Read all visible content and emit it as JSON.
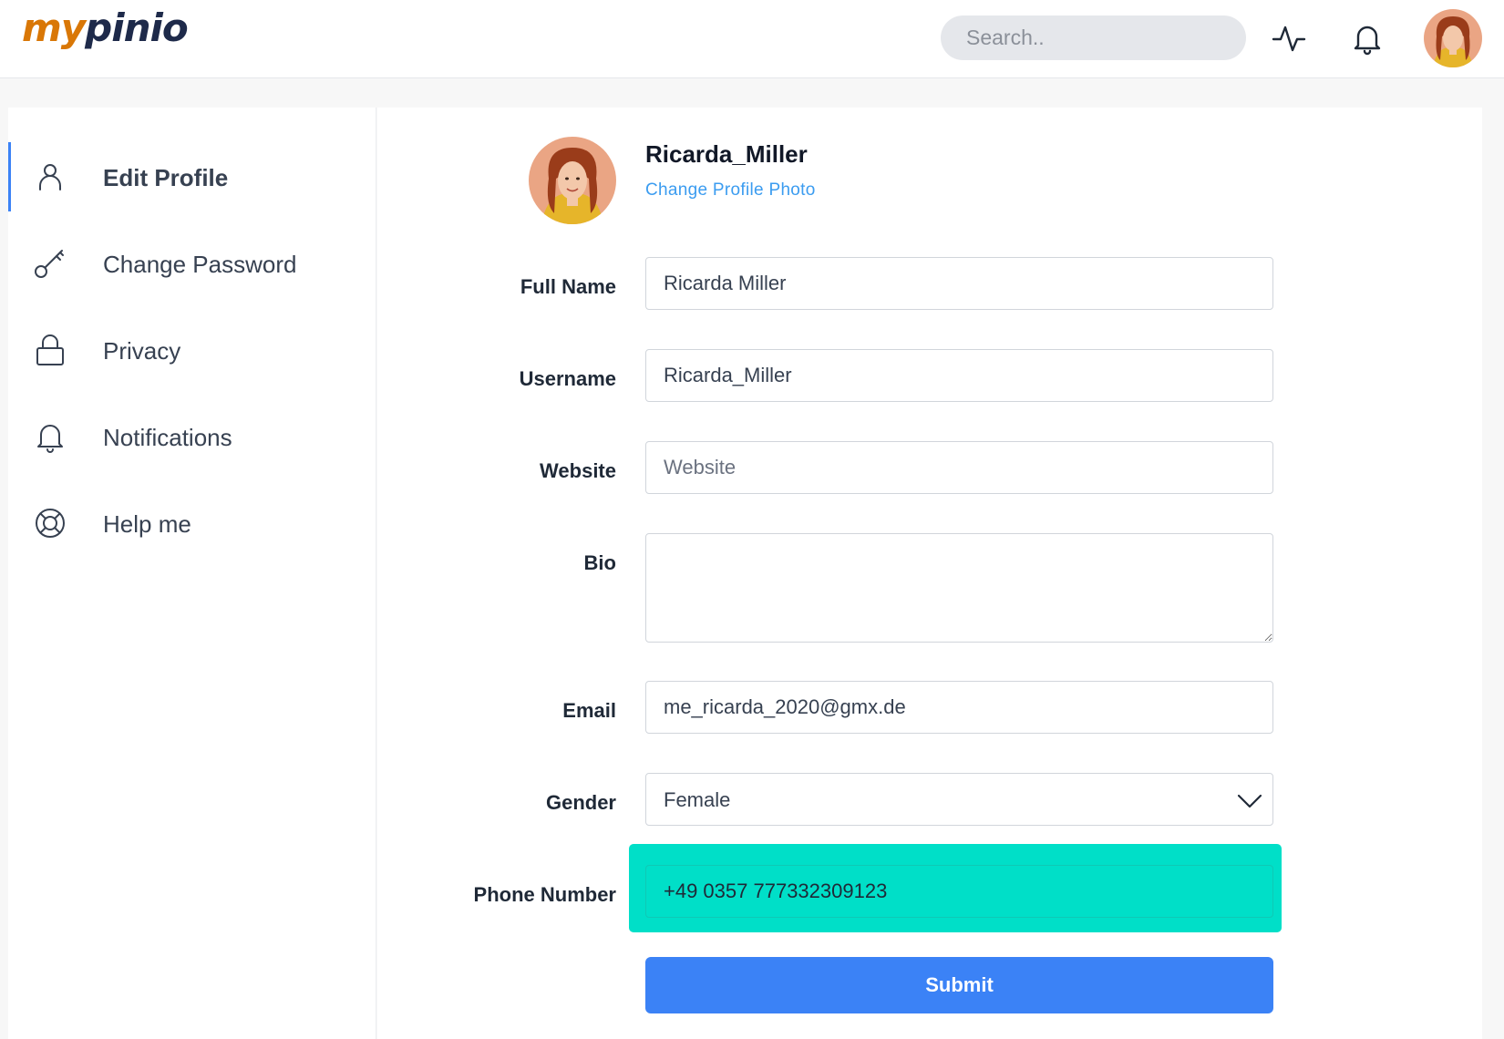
{
  "app": {
    "logo_part1": "my",
    "logo_part2": "pinio"
  },
  "header": {
    "search_placeholder": "Search..",
    "activity_icon": "activity-icon",
    "notifications_icon": "bell-icon",
    "avatar_icon": "user-avatar"
  },
  "sidebar": {
    "items": [
      {
        "label": "Edit Profile",
        "icon": "user-icon",
        "active": true
      },
      {
        "label": "Change Password",
        "icon": "key-icon",
        "active": false
      },
      {
        "label": "Privacy",
        "icon": "lock-icon",
        "active": false
      },
      {
        "label": "Notifications",
        "icon": "bell-icon",
        "active": false
      },
      {
        "label": "Help me",
        "icon": "lifebuoy-icon",
        "active": false
      }
    ]
  },
  "profile": {
    "username": "Ricarda_Miller",
    "change_photo_label": "Change Profile Photo"
  },
  "form": {
    "full_name": {
      "label": "Full Name",
      "value": "Ricarda Miller"
    },
    "username": {
      "label": "Username",
      "value": "Ricarda_Miller"
    },
    "website": {
      "label": "Website",
      "value": "",
      "placeholder": "Website"
    },
    "bio": {
      "label": "Bio",
      "value": ""
    },
    "email": {
      "label": "Email",
      "value": "me_ricarda_2020@gmx.de"
    },
    "gender": {
      "label": "Gender",
      "value": "Female"
    },
    "phone": {
      "label": "Phone Number",
      "value": "+49 0357 777332309123"
    },
    "submit_label": "Submit"
  },
  "colors": {
    "accent": "#3b82f6",
    "link": "#3b9cf0",
    "highlight": "#00dfc8",
    "logo_orange": "#d97706",
    "logo_navy": "#1e2a4a"
  }
}
